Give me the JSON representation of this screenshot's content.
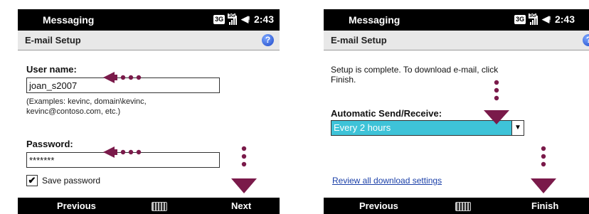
{
  "screens": [
    {
      "title_bar": {
        "app_title": "Messaging",
        "network_badge": "3G",
        "signal_mini_badge": "3G",
        "time": "2:43"
      },
      "header": {
        "title": "E-mail Setup",
        "help_icon": "help-icon"
      },
      "user_name": {
        "label": "User name:",
        "value": "joan_s2007",
        "hint_line1": "(Examples: kevinc, domain\\kevinc,",
        "hint_line2": "kevinc@contoso.com, etc.)"
      },
      "password": {
        "label": "Password:",
        "value": "*******"
      },
      "save_password": {
        "label": "Save password",
        "checked": true
      },
      "softkeys": {
        "left": "Previous",
        "right": "Next"
      }
    },
    {
      "title_bar": {
        "app_title": "Messaging",
        "network_badge": "3G",
        "signal_mini_badge": "3G",
        "time": "2:43"
      },
      "header": {
        "title": "E-mail Setup"
      },
      "message_line1": "Setup is complete.  To download e-mail, click",
      "message_line2": "Finish.",
      "auto_send": {
        "label": "Automatic Send/Receive:",
        "selected": "Every 2 hours"
      },
      "review_link": "Review all download settings",
      "softkeys": {
        "left": "Previous",
        "right": "Finish"
      }
    }
  ],
  "accent_color": "#7a1a4a"
}
